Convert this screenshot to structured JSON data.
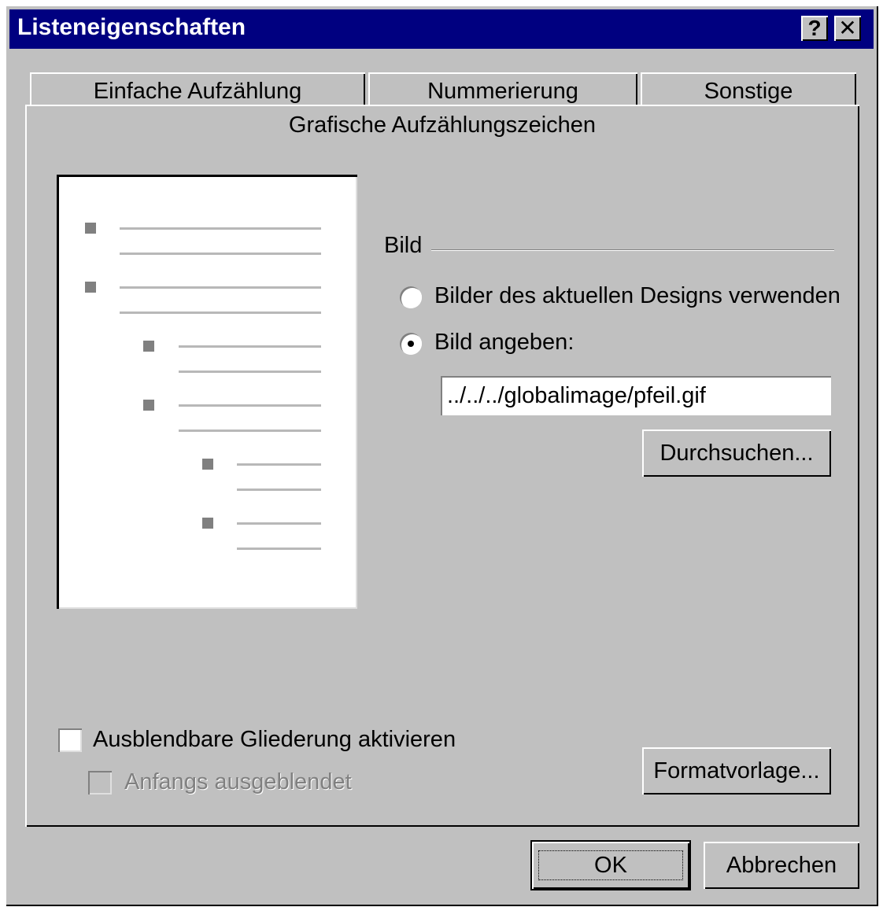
{
  "window": {
    "title": "Listeneigenschaften",
    "help_label": "?",
    "close_label": "✕",
    "colors": {
      "titlebar": "#000080",
      "face": "#c0c0c0"
    }
  },
  "tabs": [
    {
      "label": "Einfache Aufzählung"
    },
    {
      "label": "Nummerierung"
    },
    {
      "label": "Sonstige"
    }
  ],
  "active_tab": {
    "label": "Grafische Aufzählungszeichen"
  },
  "bild_group": {
    "label": "Bild",
    "radio_current_design": {
      "label": "Bilder des aktuellen Designs verwenden",
      "selected": false
    },
    "radio_specify": {
      "label": "Bild angeben:",
      "selected": true
    },
    "path_value": "../../../globalimage/pfeil.gif",
    "browse_label": "Durchsuchen..."
  },
  "outline": {
    "collapsible_label": "Ausblendbare Gliederung aktivieren",
    "collapsible_checked": false,
    "initially_hidden_label": "Anfangs ausgeblendet",
    "initially_hidden_enabled": false
  },
  "buttons": {
    "style_label": "Formatvorlage...",
    "ok_label": "OK",
    "cancel_label": "Abbrechen"
  }
}
